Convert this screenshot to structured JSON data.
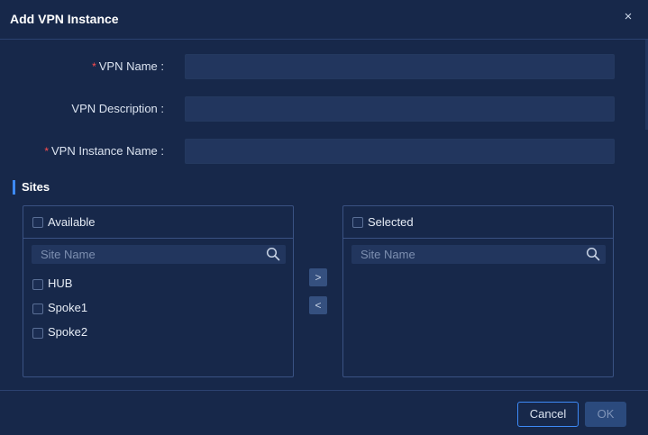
{
  "dialog": {
    "title": "Add VPN Instance",
    "close_glyph": "×"
  },
  "form": {
    "required_mark": "*",
    "vpn_name": {
      "label": "VPN Name :",
      "value": "",
      "required": true
    },
    "vpn_description": {
      "label": "VPN Description :",
      "value": "",
      "required": false
    },
    "vpn_instance_name": {
      "label": "VPN Instance Name :",
      "value": "",
      "required": true
    }
  },
  "sites": {
    "title": "Sites",
    "available": {
      "header": "Available",
      "search_placeholder": "Site Name",
      "items": [
        {
          "label": "HUB",
          "checked": false
        },
        {
          "label": "Spoke1",
          "checked": false
        },
        {
          "label": "Spoke2",
          "checked": false
        }
      ]
    },
    "selected": {
      "header": "Selected",
      "search_placeholder": "Site Name",
      "items": []
    },
    "move_right_glyph": ">",
    "move_left_glyph": "<"
  },
  "footer": {
    "cancel_label": "Cancel",
    "ok_label": "OK"
  },
  "colors": {
    "accent": "#3d8af7",
    "background": "#17284a",
    "input_bg": "#22365e",
    "required": "#ff4d4f"
  }
}
